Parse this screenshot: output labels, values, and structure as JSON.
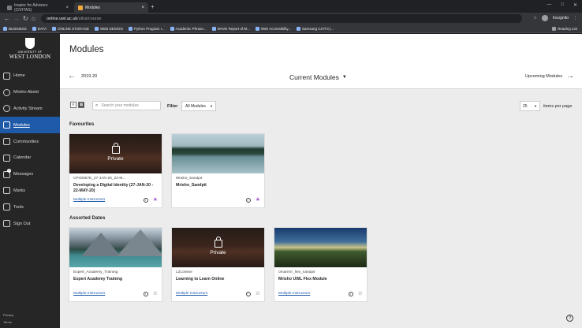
{
  "browser": {
    "tabs": [
      {
        "title": "Inspire for Advisors (CIVITAS)",
        "active": false
      },
      {
        "title": "Modules",
        "active": true
      }
    ],
    "url_host": "online.uwl.ac.uk",
    "url_path": "/ultra/course",
    "profile_label": "Incognito",
    "bookmarks": [
      "BUSINESS",
      "DATA",
      "ONLINE STORAGE",
      "WEB DESIGN",
      "Python Program I...",
      "Academic Phrase...",
      "WAVE Report of M...",
      "Web Accessibility...",
      "Samsung C27F3 |..."
    ],
    "reading_list": "Reading List"
  },
  "sidebar": {
    "logo_line1": "UNIVERSITY OF",
    "logo_line2": "WEST LONDON",
    "items": [
      {
        "label": "Home",
        "icon": "home-icon"
      },
      {
        "label": "Mrisho Abeid",
        "icon": "user-icon"
      },
      {
        "label": "Activity Stream",
        "icon": "activity-icon"
      },
      {
        "label": "Modules",
        "icon": "modules-icon",
        "active": true
      },
      {
        "label": "Communities",
        "icon": "communities-icon"
      },
      {
        "label": "Calendar",
        "icon": "calendar-icon"
      },
      {
        "label": "Messages",
        "icon": "messages-icon",
        "badge": "1"
      },
      {
        "label": "Marks",
        "icon": "marks-icon"
      },
      {
        "label": "Tools",
        "icon": "tools-icon"
      },
      {
        "label": "Sign Out",
        "icon": "signout-icon"
      }
    ],
    "footer": [
      "Privacy",
      "Terms"
    ]
  },
  "header": {
    "title": "Modules",
    "prev_term": "2019-20",
    "current": "Current Modules",
    "next_term": "Upcoming Modules"
  },
  "controls": {
    "search_placeholder": "Search your modules",
    "filter_label": "Filter",
    "filter_value": "All Modules",
    "per_page_value": "25",
    "per_page_label": "items per page"
  },
  "sections": [
    {
      "heading": "Favourites",
      "cards": [
        {
          "code": "CP40057E_27-JAN-20_22-M...",
          "name": "Developing a Digital Identity (27-JAN-20 - 22-MAY-20)",
          "instructors": "Multiple Instructors",
          "private": true,
          "favourite": true
        },
        {
          "code": "Mrisho_Sandpit",
          "name": "Mrisho_Sandpit",
          "instructors": "",
          "private": false,
          "favourite": true
        }
      ]
    },
    {
      "heading": "Assorted Dates",
      "cards": [
        {
          "code": "Expert_Academy_Training",
          "name": "Expert Academy Training",
          "instructors": "Multiple Instructors",
          "private": false,
          "favourite": false
        },
        {
          "code": "L2Lonline",
          "name": "Learning to Learn Online",
          "instructors": "Multiple Instructors",
          "private": true,
          "favourite": false
        },
        {
          "code": "omarmrr_flex_sandpit",
          "name": "Mrisho UWL Flex Module",
          "instructors": "Multiple Instructors",
          "private": false,
          "favourite": false
        }
      ]
    }
  ],
  "private_label": "Private"
}
